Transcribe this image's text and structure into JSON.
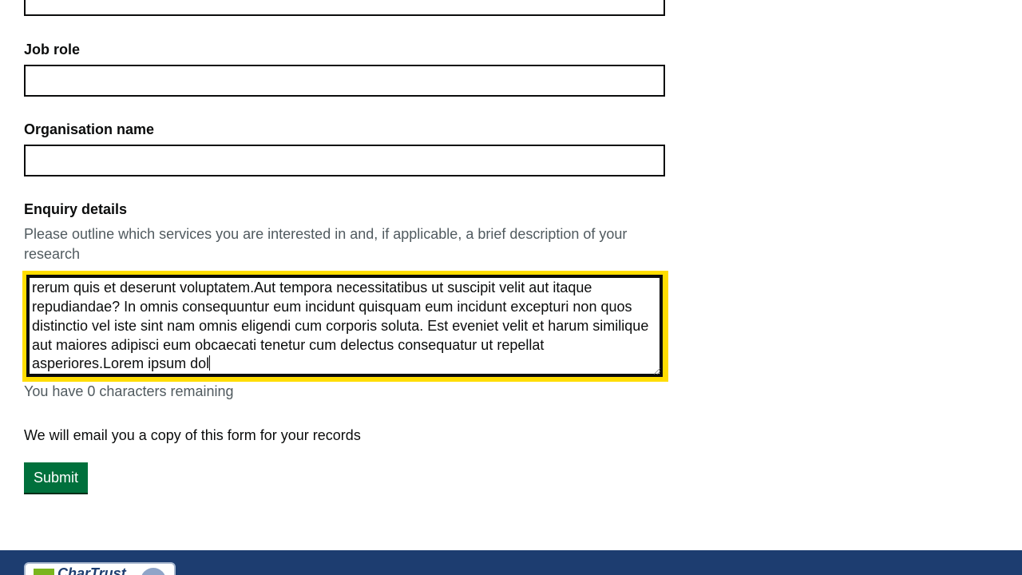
{
  "form": {
    "job_role": {
      "label": "Job role",
      "value": ""
    },
    "organisation_name": {
      "label": "Organisation name",
      "value": ""
    },
    "enquiry_details": {
      "label": "Enquiry details",
      "hint": "Please outline which services you are interested in and, if applicable, a brief description of your research",
      "value": "quibusdam perferendis est laborum laudantium ad temporibus nobis sed accusamus sint eum rerum quis et deserunt voluptatem.Aut tempora necessitatibus ut suscipit velit aut itaque repudiandae? In omnis consequuntur eum incidunt quisquam eum incidunt excepturi non quos distinctio vel iste sint nam omnis eligendi cum corporis soluta. Est eveniet velit et harum similique aut maiores adipisci eum obcaecati tenetur cum delectus consequatur ut repellat asperiores.Lorem ipsum dol",
      "counter": "You have 0 characters remaining"
    },
    "copy_note": "We will email you a copy of this form for your records",
    "submit_label": "Submit"
  },
  "footer": {
    "badge_text": "CharTrust"
  },
  "colors": {
    "focus": "#ffdd00",
    "submit": "#00703c",
    "footer": "#1d3d70",
    "hint": "#505a5f"
  }
}
